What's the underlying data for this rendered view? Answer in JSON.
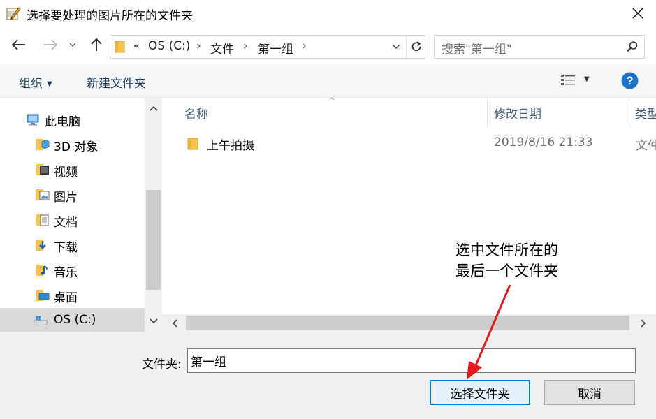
{
  "window": {
    "title": "选择要处理的图片所在的文件夹"
  },
  "address": {
    "overflow": "«",
    "segments": [
      "OS (C:)",
      "文件",
      "第一组"
    ]
  },
  "search": {
    "placeholder": "搜索\"第一组\""
  },
  "toolbar": {
    "organize": "组织",
    "new_folder": "新建文件夹"
  },
  "sidebar": {
    "items": [
      {
        "label": "此电脑",
        "icon": "computer-icon"
      },
      {
        "label": "3D 对象",
        "icon": "3d-objects-icon"
      },
      {
        "label": "视频",
        "icon": "videos-icon"
      },
      {
        "label": "图片",
        "icon": "pictures-icon"
      },
      {
        "label": "文档",
        "icon": "documents-icon"
      },
      {
        "label": "下载",
        "icon": "downloads-icon"
      },
      {
        "label": "音乐",
        "icon": "music-icon"
      },
      {
        "label": "桌面",
        "icon": "desktop-icon"
      },
      {
        "label": "OS (C:)",
        "icon": "drive-icon",
        "selected": true
      }
    ]
  },
  "list": {
    "columns": [
      "名称",
      "修改日期",
      "类型"
    ],
    "rows": [
      {
        "name": "上午拍摄",
        "modified": "2019/8/16 21:33",
        "type": "文件夹"
      }
    ]
  },
  "footer": {
    "folder_label": "文件夹:",
    "folder_value": "第一组",
    "select_button": "选择文件夹",
    "cancel_button": "取消"
  },
  "annotation": {
    "lines": [
      "选中文件所在的",
      "最后一个文件夹"
    ],
    "color": "#e8171c"
  },
  "colors": {
    "accent": "#0078d7",
    "help_blue": "#1b75d0",
    "folder_yellow": "#f4c44d"
  }
}
